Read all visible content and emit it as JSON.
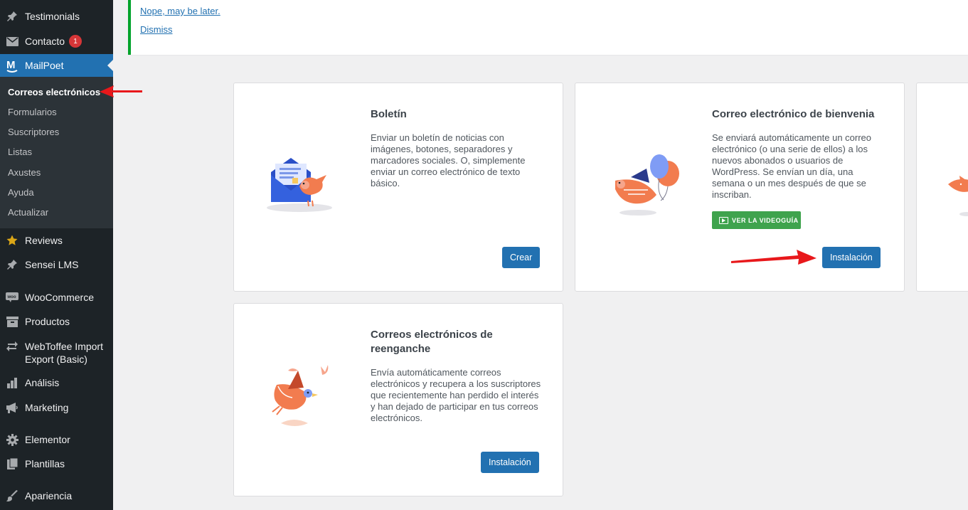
{
  "sidebar": {
    "items": [
      {
        "label": "Testimonials",
        "icon": "pin-icon"
      },
      {
        "label": "Contacto",
        "icon": "envelope-icon",
        "badge": "1"
      },
      {
        "label": "MailPoet",
        "icon": "mailpoet-icon"
      },
      {
        "label": "Reviews",
        "icon": "star-icon"
      },
      {
        "label": "Sensei LMS",
        "icon": "pin-icon"
      },
      {
        "label": "WooCommerce",
        "icon": "woo-icon"
      },
      {
        "label": "Productos",
        "icon": "archive-icon"
      },
      {
        "label": "WebToffee Import Export (Basic)",
        "icon": "sync-icon"
      },
      {
        "label": "Análisis",
        "icon": "bar-chart-icon"
      },
      {
        "label": "Marketing",
        "icon": "megaphone-icon"
      },
      {
        "label": "Elementor",
        "icon": "gear-icon"
      },
      {
        "label": "Plantillas",
        "icon": "pages-icon"
      },
      {
        "label": "Apariencia",
        "icon": "brush-icon"
      }
    ],
    "submenu": [
      "Correos electrónicos",
      "Formularios",
      "Suscriptores",
      "Listas",
      "Axustes",
      "Ayuda",
      "Actualizar"
    ]
  },
  "notice": {
    "link_later": "Nope, may be later.",
    "link_dismiss": "Dismiss"
  },
  "cards": [
    {
      "title": "Boletín",
      "desc": "Enviar un boletín de noticias con imágenes, botones, separadores y marcadores sociales. O, simplemente enviar un correo electrónico de texto básico.",
      "button": "Crear"
    },
    {
      "title": "Correo electrónico de bienvenia",
      "desc": "Se enviará automáticamente un correo electrónico (o una serie de ellos) a los nuevos abonados o usuarios de WordPress. Se envían un día, una semana o un mes después de que se inscriban.",
      "video_button": "VER LA VIDEOGUÍA",
      "button": "Instalación"
    },
    {
      "title": "Correos electrónicos de reenganche",
      "desc": "Envía automáticamente correos electrónicos y recupera a los suscriptores que recientemente han perdido el interés y han dejado de participar en tus correos electrónicos.",
      "button": "Instalación"
    }
  ],
  "colors": {
    "sidebar_bg": "#1d2327",
    "accent": "#2271b1",
    "notice_border": "#00a32a",
    "video_button": "#3fa34d",
    "badge": "#d63638",
    "annotation_arrow": "#e8181b"
  }
}
